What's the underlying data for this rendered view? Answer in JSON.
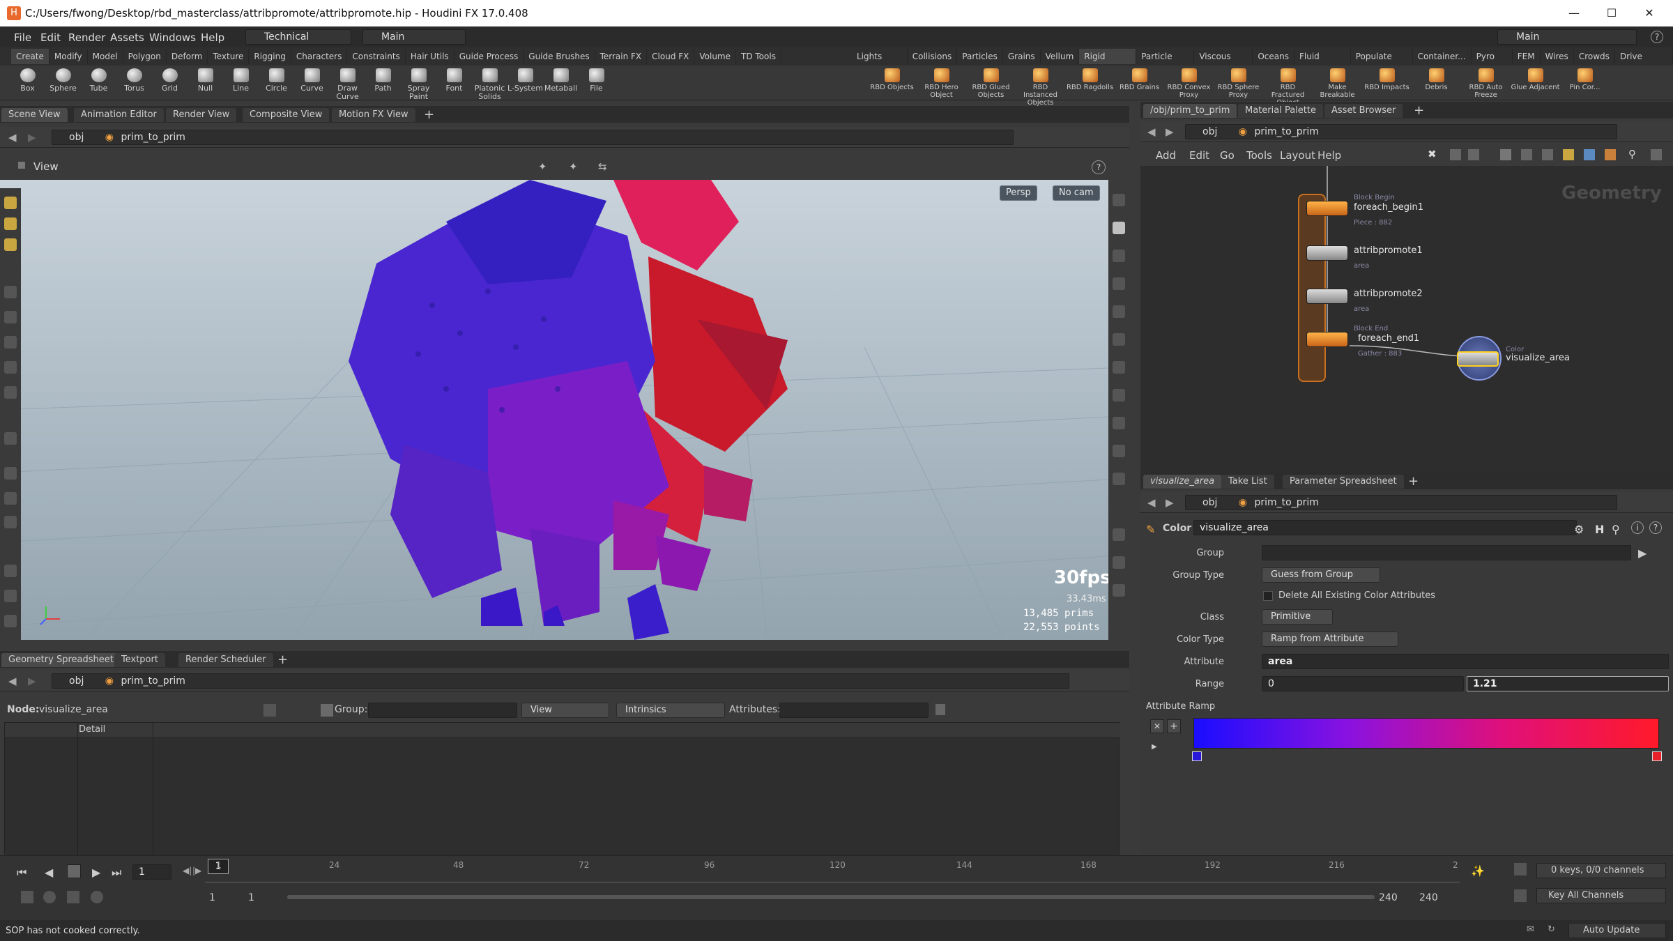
{
  "window": {
    "title": "C:/Users/fwong/Desktop/rbd_masterclass/attribpromote/attribpromote.hip - Houdini FX 17.0.408"
  },
  "menubar": {
    "items": [
      "File",
      "Edit",
      "Render",
      "Assets",
      "Windows",
      "Help"
    ],
    "desktop": "Technical",
    "main": "Main",
    "right_main": "Main"
  },
  "shelf_tabs_left": [
    "Create",
    "Modify",
    "Model",
    "Polygon",
    "Deform",
    "Texture",
    "Rigging",
    "Characters",
    "Constraints",
    "Hair Utils",
    "Guide Process",
    "Guide Brushes",
    "Terrain FX",
    "Cloud FX",
    "Volume",
    "TD Tools"
  ],
  "shelf_tabs_right": [
    "Lights an...",
    "Collisions",
    "Particles",
    "Grains",
    "Vellum",
    "Rigid Bod...",
    "Particle Fl...",
    "Viscous Fl...",
    "Oceans",
    "Fluid Con...",
    "Populate C...",
    "Container...",
    "Pyro FX",
    "FEM",
    "Wires",
    "Crowds",
    "Drive Sim..."
  ],
  "shelf_tools_left": [
    "Box",
    "Sphere",
    "Tube",
    "Torus",
    "Grid",
    "Null",
    "Line",
    "Circle",
    "Curve",
    "Draw Curve",
    "Path",
    "Spray Paint",
    "Font",
    "Platonic Solids",
    "L-System",
    "Metaball",
    "File"
  ],
  "shelf_tools_right": [
    "RBD Objects",
    "RBD Hero Object",
    "RBD Glued Objects",
    "RBD Instanced Objects",
    "RBD Ragdolls",
    "RBD Grains",
    "RBD Convex Proxy",
    "RBD Sphere Proxy",
    "RBD Fractured Object",
    "Make Breakable",
    "RBD Impacts",
    "Debris",
    "RBD Auto Freeze",
    "Glue Adjacent",
    "Pin Cor..."
  ],
  "left_pane": {
    "tabs": [
      "Scene View",
      "Animation Editor",
      "Render View",
      "Composite View",
      "Motion FX View"
    ],
    "path_root": "obj",
    "path_node": "prim_to_prim",
    "view_label": "View",
    "persp": "Persp",
    "cam": "No cam",
    "fps": "30fps",
    "ms": "33.43ms",
    "prims": "13,485  prims",
    "points": "22,553  points"
  },
  "spreadsheet": {
    "tabs": [
      "Geometry Spreadsheet",
      "Textport",
      "Render Scheduler"
    ],
    "path_root": "obj",
    "path_node": "prim_to_prim",
    "node_label": "Node:",
    "node_value": "visualize_area",
    "group_label": "Group:",
    "view_label": "View",
    "intrinsics_label": "Intrinsics",
    "attributes_label": "Attributes:",
    "column_detail": "Detail"
  },
  "network": {
    "tabs": [
      "/obj/prim_to_prim",
      "Material Palette",
      "Asset Browser"
    ],
    "path_root": "obj",
    "path_node": "prim_to_prim",
    "menu": [
      "Add",
      "Edit",
      "Go",
      "Tools",
      "Layout",
      "Help"
    ],
    "context_label": "Geometry",
    "nodes": [
      {
        "name": "foreach_begin1",
        "top": "Block Begin",
        "sub": "Piece : 882"
      },
      {
        "name": "attribpromote1",
        "sub": "area"
      },
      {
        "name": "attribpromote2",
        "sub": "area"
      },
      {
        "name": "foreach_end1",
        "top": "Block End",
        "sub": "Gather : 883"
      },
      {
        "name": "visualize_area",
        "top": "Color"
      }
    ]
  },
  "params": {
    "tabs": [
      "visualize_area",
      "Take List",
      "Parameter Spreadsheet"
    ],
    "path_root": "obj",
    "path_node": "prim_to_prim",
    "node_type": "Color",
    "node_name": "visualize_area",
    "group_label": "Group",
    "group_value": "",
    "group_type_label": "Group Type",
    "group_type_value": "Guess from Group",
    "delete_attr_label": "Delete All Existing Color Attributes",
    "class_label": "Class",
    "class_value": "Primitive",
    "color_type_label": "Color Type",
    "color_type_value": "Ramp from Attribute",
    "attribute_label": "Attribute",
    "attribute_value": "area",
    "range_label": "Range",
    "range_min": "0",
    "range_max": "1.21",
    "ramp_label": "Attribute Ramp",
    "ramp_colors": [
      "#1a0dff",
      "#8a12e0",
      "#e0107a",
      "#ff1a2a"
    ]
  },
  "timeline": {
    "ticks": [
      "1",
      "24",
      "48",
      "72",
      "96",
      "120",
      "144",
      "168",
      "192",
      "216",
      "2"
    ],
    "current_frame": "1",
    "start": "1",
    "start2": "1",
    "end": "240",
    "end2": "240",
    "keys_info": "0 keys, 0/0 channels",
    "key_all": "Key All Channels"
  },
  "status": {
    "message": "SOP has not cooked correctly.",
    "auto_update": "Auto Update"
  }
}
